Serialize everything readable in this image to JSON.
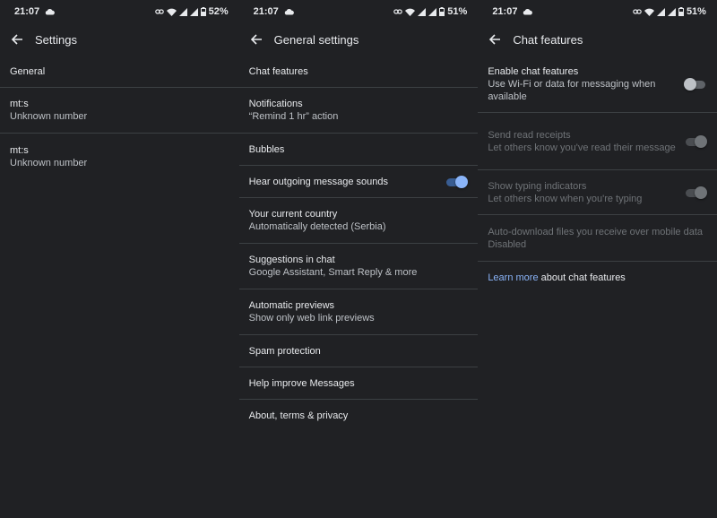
{
  "screens": [
    {
      "status": {
        "time": "21:07",
        "battery": "52%"
      },
      "title": "Settings",
      "items": [
        {
          "primary": "General"
        },
        {
          "primary": "mt:s",
          "secondary": "Unknown number"
        },
        {
          "primary": "mt:s",
          "secondary": "Unknown number"
        }
      ]
    },
    {
      "status": {
        "time": "21:07",
        "battery": "51%"
      },
      "title": "General settings",
      "items": [
        {
          "primary": "Chat features"
        },
        {
          "primary": "Notifications",
          "secondary": "“Remind 1 hr” action"
        },
        {
          "primary": "Bubbles"
        },
        {
          "primary": "Hear outgoing message sounds",
          "toggle": "on"
        },
        {
          "primary": "Your current country",
          "secondary": "Automatically detected (Serbia)"
        },
        {
          "primary": "Suggestions in chat",
          "secondary": "Google Assistant, Smart Reply & more"
        },
        {
          "primary": "Automatic previews",
          "secondary": "Show only web link previews"
        },
        {
          "primary": "Spam protection"
        },
        {
          "primary": "Help improve Messages"
        },
        {
          "primary": "About, terms & privacy"
        }
      ]
    },
    {
      "status": {
        "time": "21:07",
        "battery": "51%"
      },
      "title": "Chat features",
      "items": [
        {
          "primary": "Enable chat features",
          "secondary": "Use Wi-Fi or data for messaging when available",
          "toggle": "off"
        },
        {
          "primary": "Send read receipts",
          "secondary": "Let others know you've read their message",
          "toggle": "disabled"
        },
        {
          "primary": "Show typing indicators",
          "secondary": "Let others know when you're typing",
          "toggle": "disabled"
        },
        {
          "primary": "Auto-download files you receive over mobile data",
          "secondary": "Disabled",
          "disabled": true
        }
      ],
      "footer": {
        "link": "Learn more",
        "text": " about chat features"
      }
    }
  ],
  "colors": {
    "accent": "#8ab4f8",
    "background": "#202124",
    "divider": "#3c4043"
  },
  "icons": [
    "cloud-icon",
    "link-icon",
    "wifi-icon",
    "signal-icon",
    "battery-icon",
    "back-arrow-icon"
  ]
}
